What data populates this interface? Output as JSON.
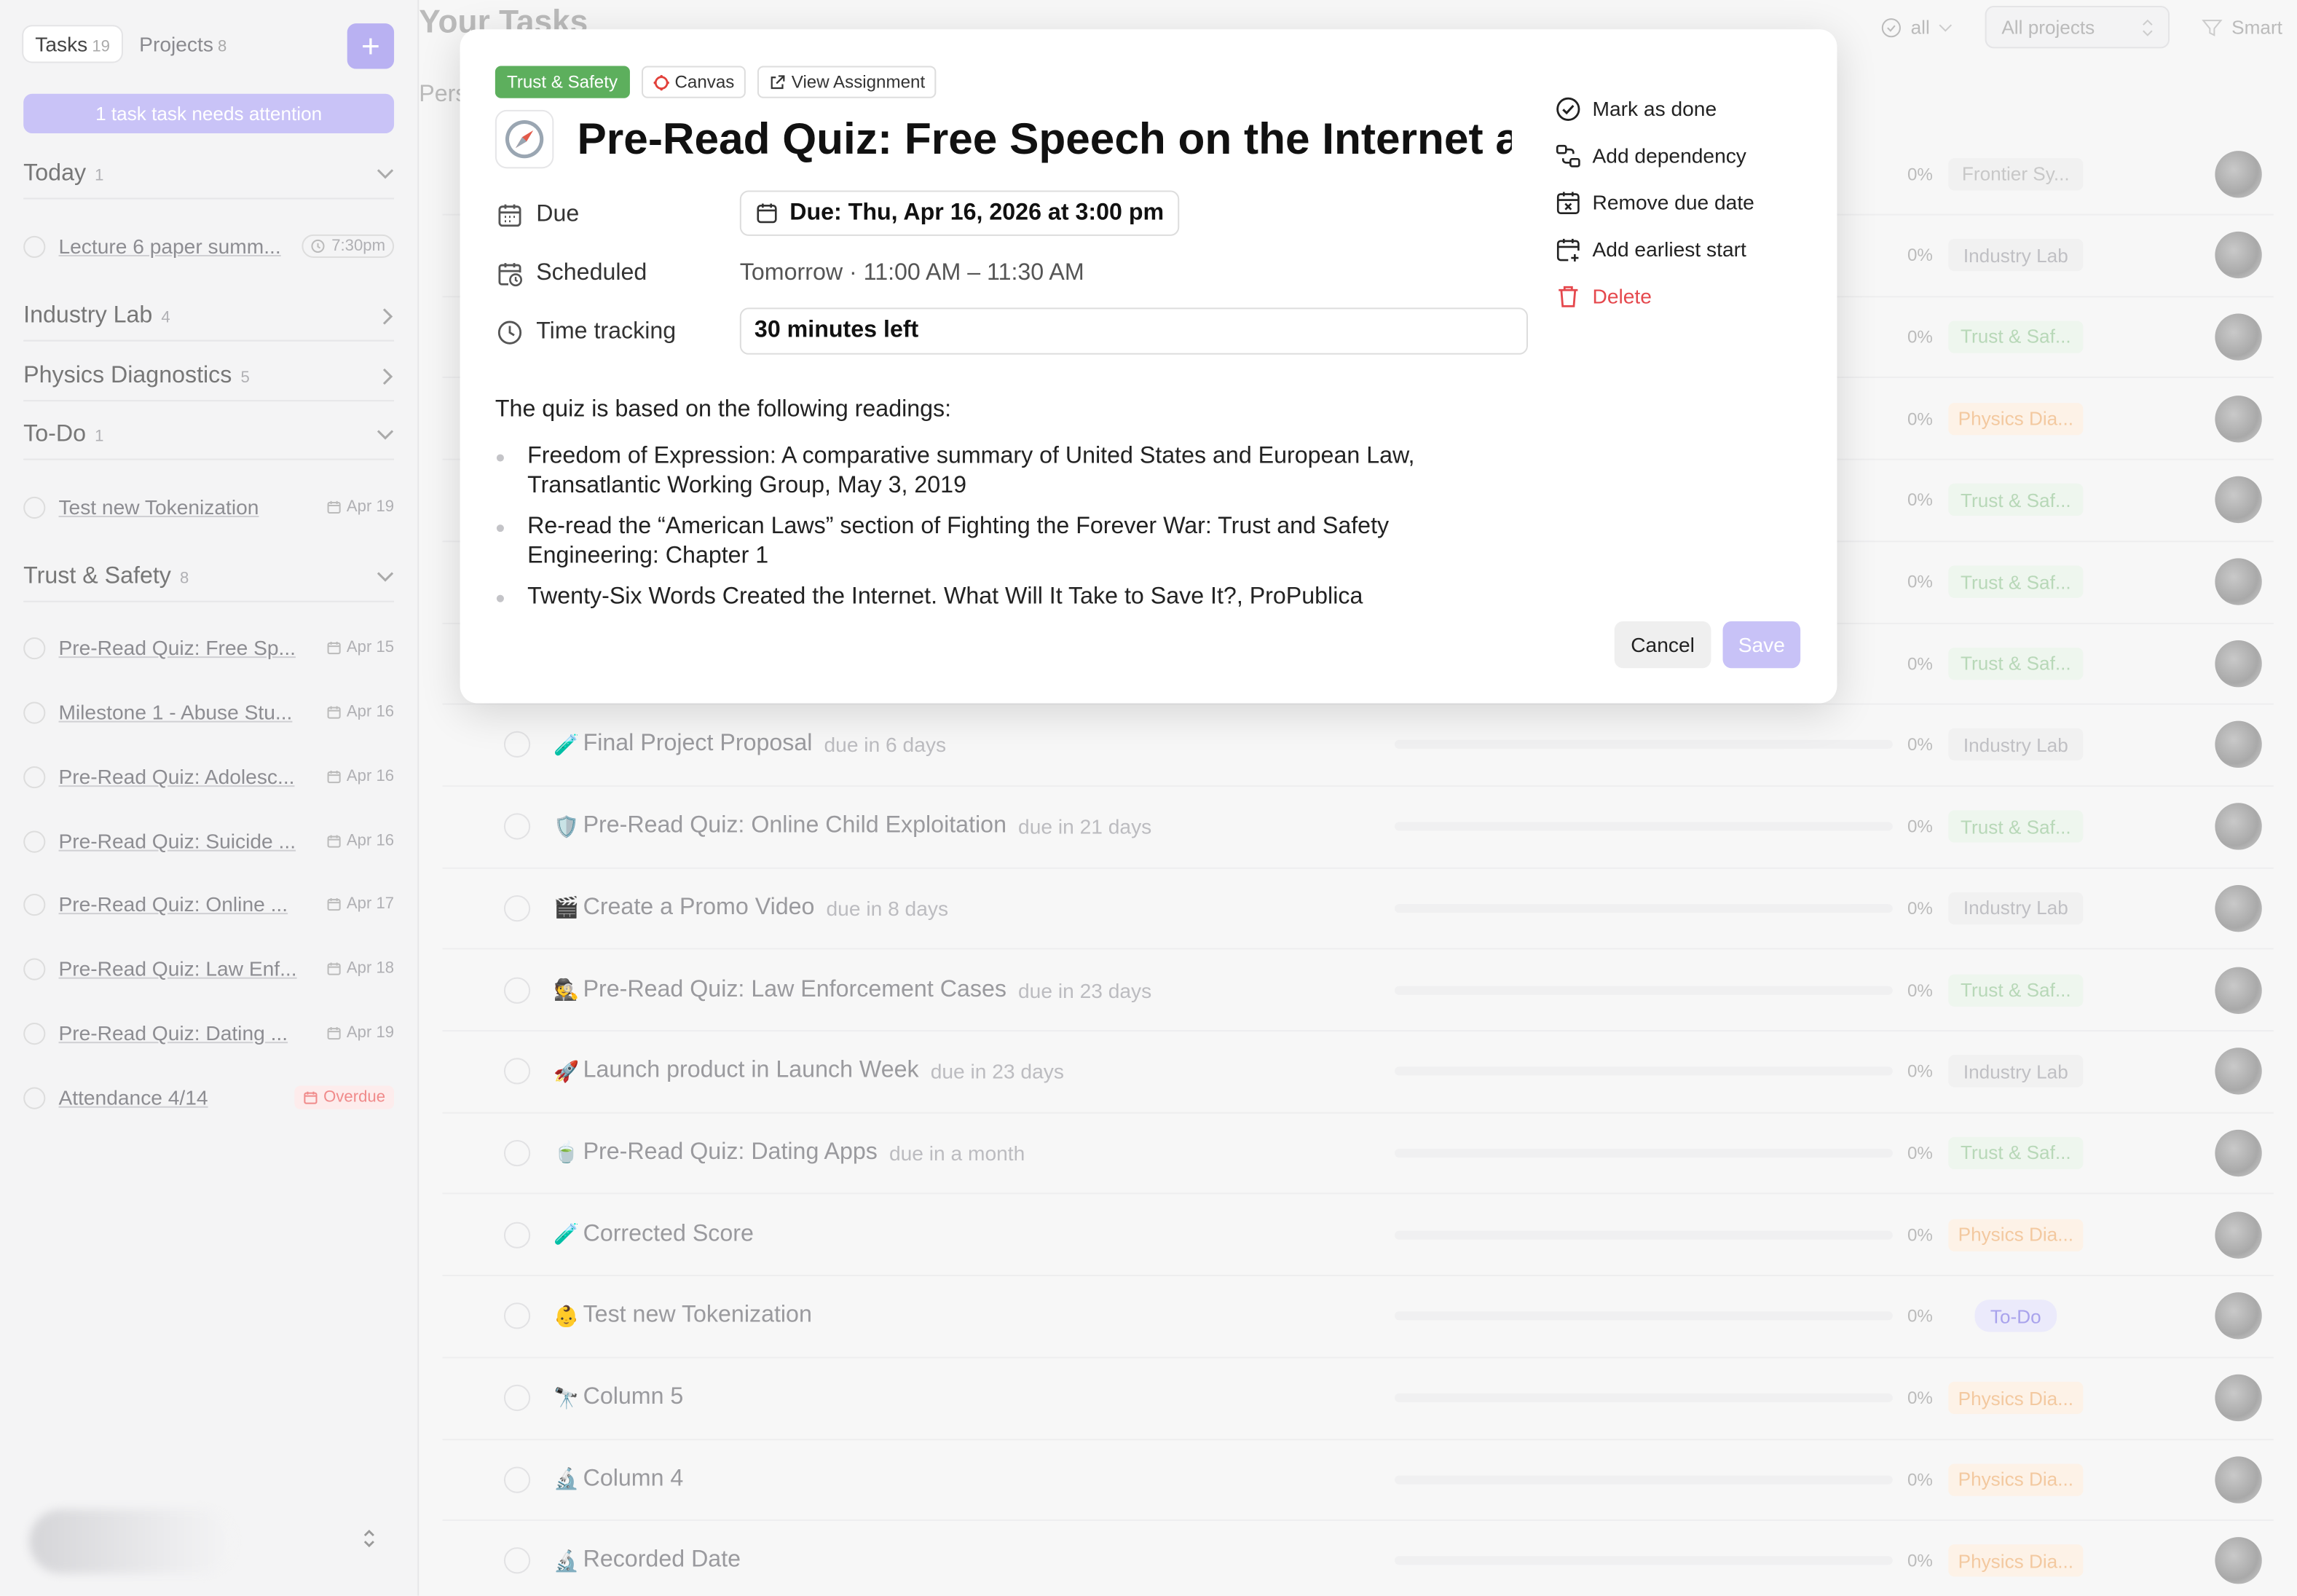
{
  "sidebar": {
    "tabs": [
      {
        "label": "Tasks",
        "count": "19"
      },
      {
        "label": "Projects",
        "count": "8"
      }
    ],
    "add_label": "+",
    "attention": "1 task task needs attention",
    "sections": {
      "today": {
        "name": "Today",
        "count": "1"
      },
      "industry": {
        "name": "Industry Lab",
        "count": "4"
      },
      "physics": {
        "name": "Physics Diagnostics",
        "count": "5"
      },
      "todo": {
        "name": "To-Do",
        "count": "1"
      },
      "trust": {
        "name": "Trust & Safety",
        "count": "8"
      }
    },
    "today_tasks": [
      {
        "title": "Lecture 6 paper summ...",
        "date": "7:30pm"
      }
    ],
    "todo_tasks": [
      {
        "title": "Test new Tokenization",
        "date": "Apr 19"
      }
    ],
    "trust_tasks": [
      {
        "title": "Pre-Read Quiz: Free Sp...",
        "date": "Apr 15"
      },
      {
        "title": "Milestone 1 - Abuse Stu...",
        "date": "Apr 16"
      },
      {
        "title": "Pre-Read Quiz: Adolesc...",
        "date": "Apr 16"
      },
      {
        "title": "Pre-Read Quiz: Suicide ...",
        "date": "Apr 16"
      },
      {
        "title": "Pre-Read Quiz: Online ...",
        "date": "Apr 17"
      },
      {
        "title": "Pre-Read Quiz: Law Enf...",
        "date": "Apr 18"
      },
      {
        "title": "Pre-Read Quiz: Dating ...",
        "date": "Apr 19"
      },
      {
        "title": "Attendance 4/14",
        "date": "Overdue"
      }
    ]
  },
  "main": {
    "title": "Your Tasks",
    "subheading": "Pers",
    "filters": {
      "status": "all",
      "projects": "All projects",
      "sort": "Smart"
    },
    "rows": [
      {
        "emoji": "",
        "title": "",
        "due": "",
        "pct": "0%",
        "project": "Frontier Sy...",
        "kind": "frontier"
      },
      {
        "emoji": "",
        "title": "",
        "due": "",
        "pct": "0%",
        "project": "Industry Lab",
        "kind": "industry"
      },
      {
        "emoji": "",
        "title": "",
        "due": "",
        "pct": "0%",
        "project": "Trust & Saf...",
        "kind": "trust"
      },
      {
        "emoji": "",
        "title": "",
        "due": "",
        "pct": "0%",
        "project": "Physics Dia...",
        "kind": "physics"
      },
      {
        "emoji": "",
        "title": "",
        "due": "",
        "pct": "0%",
        "project": "Trust & Saf...",
        "kind": "trust"
      },
      {
        "emoji": "",
        "title": "",
        "due": "",
        "pct": "0%",
        "project": "Trust & Saf...",
        "kind": "trust"
      },
      {
        "emoji": "",
        "title": "",
        "due": "",
        "pct": "0%",
        "project": "Trust & Saf...",
        "kind": "trust"
      },
      {
        "emoji": "🧪",
        "title": "Final Project Proposal",
        "due": "due in 6 days",
        "pct": "0%",
        "project": "Industry Lab",
        "kind": "industry"
      },
      {
        "emoji": "🛡️",
        "title": "Pre-Read Quiz: Online Child Exploitation",
        "due": "due in 21 days",
        "pct": "0%",
        "project": "Trust & Saf...",
        "kind": "trust"
      },
      {
        "emoji": "🎬",
        "title": "Create a Promo Video",
        "due": "due in 8 days",
        "pct": "0%",
        "project": "Industry Lab",
        "kind": "industry"
      },
      {
        "emoji": "🕵",
        "title": "Pre-Read Quiz: Law Enforcement Cases",
        "due": "due in 23 days",
        "pct": "0%",
        "project": "Trust & Saf...",
        "kind": "trust"
      },
      {
        "emoji": "🚀",
        "title": "Launch product in Launch Week",
        "due": "due in 23 days",
        "pct": "0%",
        "project": "Industry Lab",
        "kind": "industry"
      },
      {
        "emoji": "🍵",
        "title": "Pre-Read Quiz: Dating Apps",
        "due": "due in a month",
        "pct": "0%",
        "project": "Trust & Saf...",
        "kind": "trust"
      },
      {
        "emoji": "🧪",
        "title": "Corrected Score",
        "due": "",
        "pct": "0%",
        "project": "Physics Dia...",
        "kind": "physics"
      },
      {
        "emoji": "👶",
        "title": "Test new Tokenization",
        "due": "",
        "pct": "0%",
        "project": "To-Do",
        "kind": "todo"
      },
      {
        "emoji": "🔭",
        "title": "Column 5",
        "due": "",
        "pct": "0%",
        "project": "Physics Dia...",
        "kind": "physics"
      },
      {
        "emoji": "🔬",
        "title": "Column 4",
        "due": "",
        "pct": "0%",
        "project": "Physics Dia...",
        "kind": "physics"
      },
      {
        "emoji": "🔬",
        "title": "Recorded Date",
        "due": "",
        "pct": "0%",
        "project": "Physics Dia...",
        "kind": "physics"
      }
    ]
  },
  "modal": {
    "tag": "Trust & Safety",
    "canvas_label": "Canvas",
    "view_label": "View Assignment",
    "title": "Pre-Read Quiz: Free Speech on the Internet and the Law",
    "due_label": "Due",
    "due_value": "Due: Thu, Apr 16, 2026 at 3:00 pm",
    "scheduled_label": "Scheduled",
    "scheduled_value": "Tomorrow · 11:00 AM – 11:30 AM",
    "time_label": "Time tracking",
    "time_value": "30 minutes left",
    "description_intro": "The quiz is based on the following readings:",
    "readings": [
      "Freedom of Expression: A comparative summary of United States and European Law, Transatlantic Working Group, May 3, 2019",
      "Re-read the “American Laws” section of Fighting the Forever War: Trust and Safety Engineering: Chapter 1",
      "Twenty-Six Words Created the Internet. What Will It Take to Save It?, ProPublica"
    ],
    "actions": {
      "mark_done": "Mark as done",
      "add_dependency": "Add dependency",
      "remove_due": "Remove due date",
      "add_earliest": "Add earliest start",
      "delete": "Delete"
    },
    "cancel_label": "Cancel",
    "save_label": "Save"
  }
}
